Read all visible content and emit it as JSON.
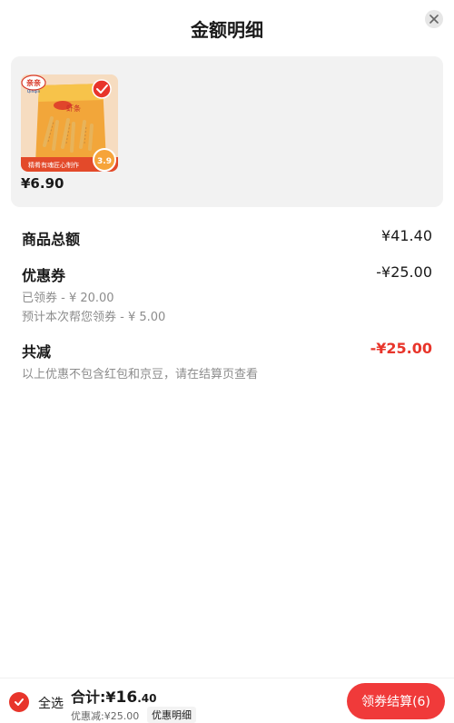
{
  "header": {
    "title": "金额明细"
  },
  "product": {
    "brand": "亲亲",
    "brand_en": "Qinqin",
    "product_name": "虾条",
    "package_tagline": "精肴有魂匠心制作",
    "package_price": "3.9",
    "price": "¥6.90"
  },
  "summary": {
    "goods_total_label": "商品总额",
    "goods_total_value": "¥41.40",
    "coupon_label": "优惠券",
    "coupon_value": "-¥25.00",
    "coupon_claimed": "已领券 - ¥ 20.00",
    "coupon_estimated": "预计本次帮您领券 - ¥ 5.00",
    "total_reduce_label": "共减",
    "total_reduce_value": "-¥25.00",
    "note": "以上优惠不包含红包和京豆，请在结算页查看"
  },
  "bottom": {
    "select_all": "全选",
    "total_prefix": "合计:¥",
    "total_int": "16",
    "total_dec": ".40",
    "discount": "优惠减:¥25.00",
    "detail_tag": "优惠明细",
    "checkout": "领券结算(6)"
  },
  "colors": {
    "accent": "#e8352b",
    "reduce": "#e8352b"
  }
}
